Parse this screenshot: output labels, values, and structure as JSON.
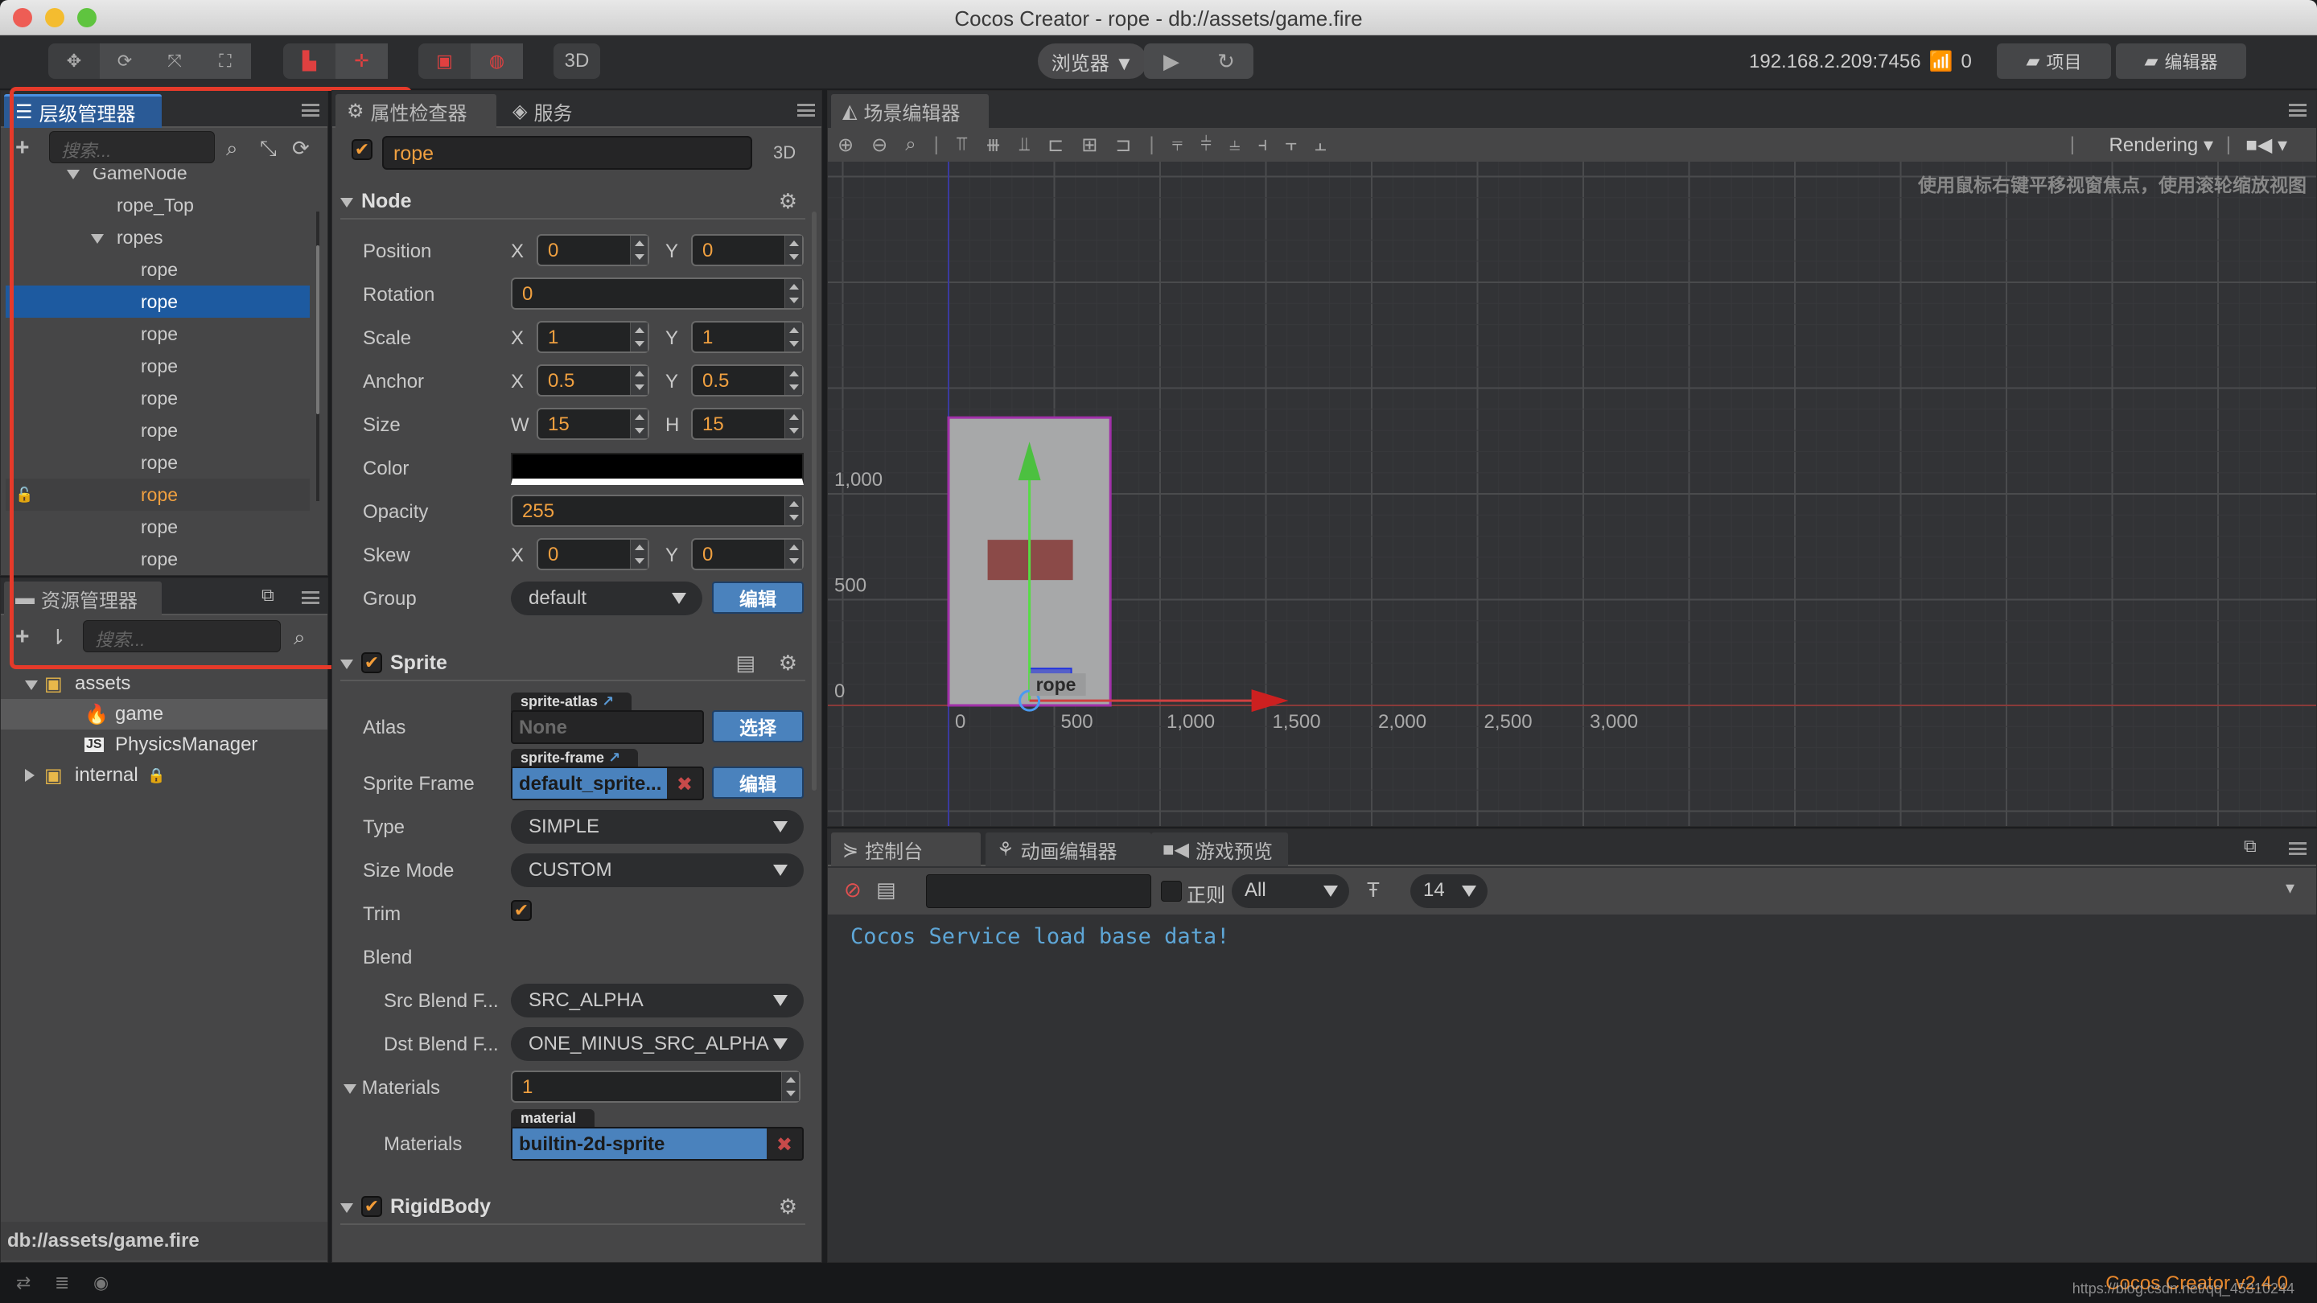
{
  "window": {
    "title": "Cocos Creator - rope - db://assets/game.fire"
  },
  "toolbar": {
    "transform_tools": [
      "move-tool-icon",
      "rotate-tool-icon",
      "scale-tool-icon",
      "rect-tool-icon"
    ],
    "pivot_tools": [
      "pivot-icon",
      "center-icon"
    ],
    "coord_tools": [
      "local-icon",
      "global-icon"
    ],
    "mode_3d_label": "3D",
    "preview_platform": "浏览器 ▼",
    "ip_address": "192.168.2.209:7456",
    "connected_devices": "0",
    "project_label": "项目",
    "editor_label": "编辑器"
  },
  "hierarchy": {
    "tab_label": "层级管理器",
    "search_placeholder": "搜索...",
    "nodes": [
      {
        "label": "GameNode",
        "depth": 1,
        "expanded": true
      },
      {
        "label": "rope_Top",
        "depth": 2
      },
      {
        "label": "ropes",
        "depth": 2,
        "expanded": true
      },
      {
        "label": "rope",
        "depth": 3
      },
      {
        "label": "rope",
        "depth": 3,
        "selected": true
      },
      {
        "label": "rope",
        "depth": 3
      },
      {
        "label": "rope",
        "depth": 3
      },
      {
        "label": "rope",
        "depth": 3
      },
      {
        "label": "rope",
        "depth": 3
      },
      {
        "label": "rope",
        "depth": 3
      },
      {
        "label": "rope",
        "depth": 3,
        "hovered": true,
        "lock_icon": true
      },
      {
        "label": "rope",
        "depth": 3
      },
      {
        "label": "rope",
        "depth": 3
      }
    ]
  },
  "assets": {
    "tab_label": "资源管理器",
    "search_placeholder": "搜索...",
    "items": [
      {
        "label": "assets",
        "type": "folder",
        "expanded": true
      },
      {
        "label": "game",
        "type": "scene",
        "selected": true
      },
      {
        "label": "PhysicsManager",
        "type": "script"
      },
      {
        "label": "internal",
        "type": "folder",
        "locked": true
      }
    ],
    "footer_path": "db://assets/game.fire"
  },
  "inspector": {
    "tab_label": "属性检查器",
    "service_tab_label": "服务",
    "node_name": "rope",
    "node_active": true,
    "mode_3d_label": "3D",
    "node_section": {
      "title": "Node",
      "position": {
        "label": "Position",
        "x_axis": "X",
        "x": "0",
        "y_axis": "Y",
        "y": "0"
      },
      "rotation": {
        "label": "Rotation",
        "value": "0"
      },
      "scale": {
        "label": "Scale",
        "x_axis": "X",
        "x": "1",
        "y_axis": "Y",
        "y": "1"
      },
      "anchor": {
        "label": "Anchor",
        "x_axis": "X",
        "x": "0.5",
        "y_axis": "Y",
        "y": "0.5"
      },
      "size": {
        "label": "Size",
        "w_axis": "W",
        "w": "15",
        "h_axis": "H",
        "h": "15"
      },
      "color": {
        "label": "Color",
        "value": "#000000"
      },
      "opacity": {
        "label": "Opacity",
        "value": "255"
      },
      "skew": {
        "label": "Skew",
        "x_axis": "X",
        "x": "0",
        "y_axis": "Y",
        "y": "0"
      },
      "group": {
        "label": "Group",
        "value": "default",
        "edit_label": "编辑"
      }
    },
    "sprite_section": {
      "title": "Sprite",
      "enabled": true,
      "atlas": {
        "label": "Atlas",
        "tag": "sprite-atlas",
        "value": "None",
        "button": "选择"
      },
      "sprite_frame": {
        "label": "Sprite Frame",
        "tag": "sprite-frame",
        "value": "default_sprite...",
        "button": "编辑"
      },
      "type": {
        "label": "Type",
        "value": "SIMPLE"
      },
      "size_mode": {
        "label": "Size Mode",
        "value": "CUSTOM"
      },
      "trim": {
        "label": "Trim",
        "checked": true
      },
      "blend": {
        "label": "Blend"
      },
      "src_blend": {
        "label": "Src Blend F...",
        "value": "SRC_ALPHA"
      },
      "dst_blend": {
        "label": "Dst Blend F...",
        "value": "ONE_MINUS_SRC_ALPHA"
      },
      "materials_count": {
        "label": "Materials",
        "value": "1"
      },
      "material": {
        "label": "Materials",
        "tag": "material",
        "value": "builtin-2d-sprite"
      }
    },
    "rigidbody_section": {
      "title": "RigidBody",
      "enabled": true
    }
  },
  "scene": {
    "tab_label": "场景编辑器",
    "hint": "使用鼠标右键平移视窗焦点，使用滚轮缩放视图",
    "render_mode": "Rendering",
    "y_ticks": [
      "1,000",
      "500",
      "0"
    ],
    "x_ticks": [
      "0",
      "500",
      "1,000",
      "1,500",
      "2,000",
      "2,500",
      "3,000"
    ],
    "selected_node_label": "rope"
  },
  "console": {
    "tabs": [
      "控制台",
      "动画编辑器",
      "游戏预览"
    ],
    "filter_value": "",
    "regex_label": "正则",
    "level_filter": "All",
    "font_size": "14",
    "logs": [
      "Cocos Service load base data!"
    ]
  },
  "statusbar": {
    "version": "Cocos Creator v2.4.0",
    "watermark": "https://blog.csdn.net/qq_45310244"
  }
}
